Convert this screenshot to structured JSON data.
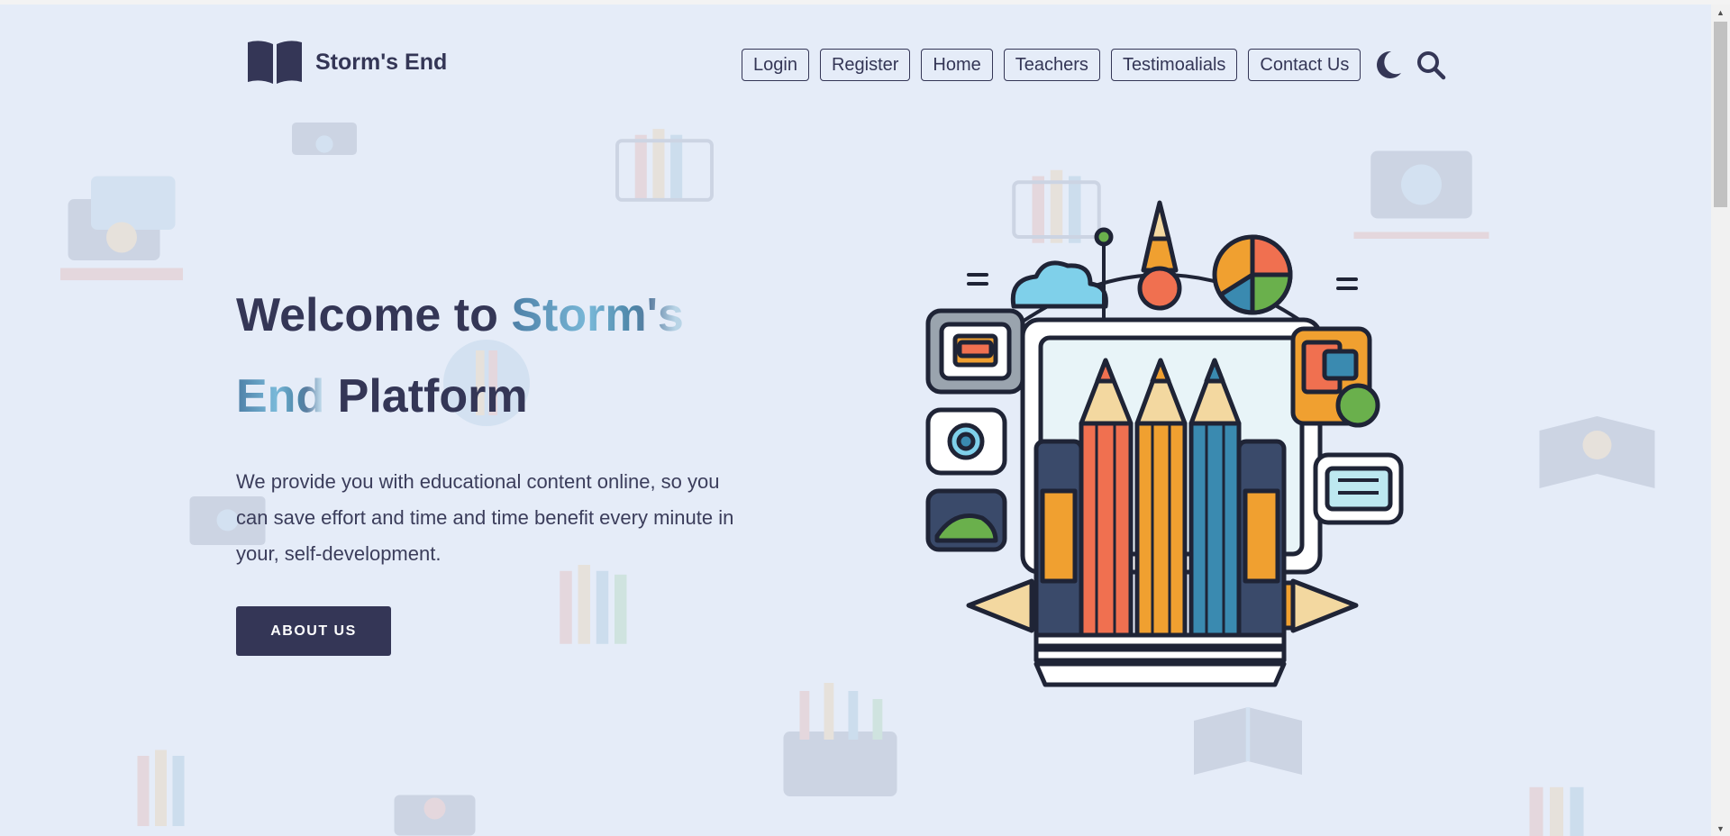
{
  "brand": {
    "name": "Storm's End",
    "logo_icon": "open-book-icon"
  },
  "nav": {
    "items": [
      {
        "label": "Login"
      },
      {
        "label": "Register"
      },
      {
        "label": "Home"
      },
      {
        "label": "Teachers"
      },
      {
        "label": "Testimoalials"
      },
      {
        "label": "Contact Us"
      }
    ],
    "theme_toggle_icon": "moon-icon",
    "search_icon": "search-icon"
  },
  "hero": {
    "title_prefix": "Welcome to ",
    "title_highlight_1": "Storm's",
    "title_highlight_2": "End",
    "title_suffix": " Platform",
    "description": "We provide you with educational content online, so you can save effort and time and time benefit every minute in your, self-development.",
    "button_label": "ABOUT US",
    "illustration_icon": "pencils-education-illustration"
  },
  "colors": {
    "background": "#e5ecf8",
    "primary": "#343656",
    "highlight": "#6aa6c8"
  }
}
